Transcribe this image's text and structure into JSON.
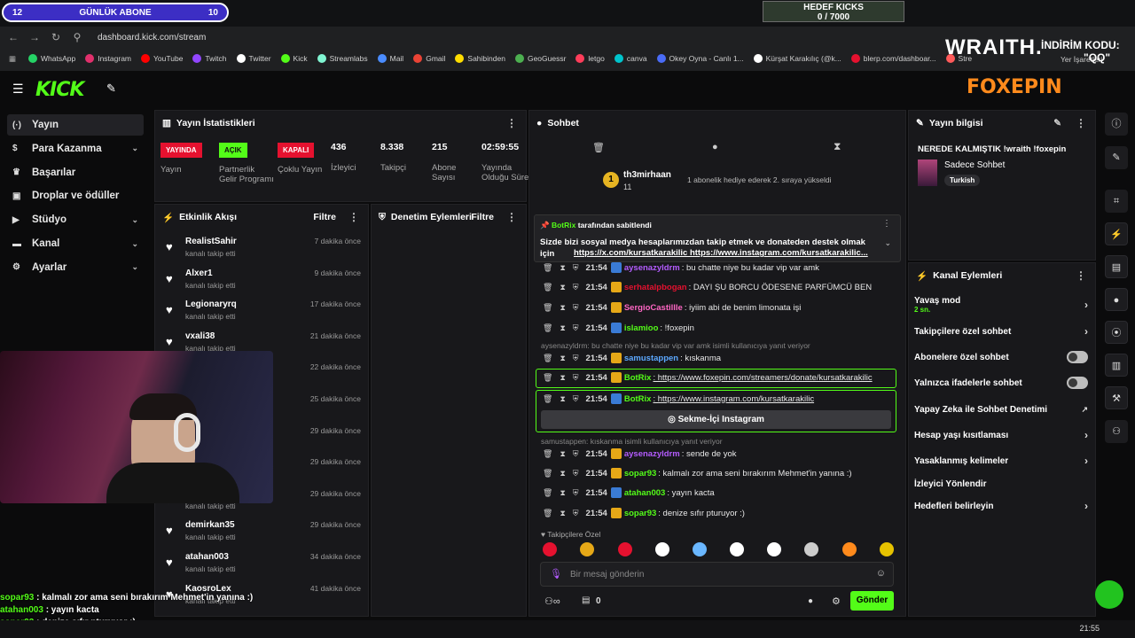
{
  "overlay": {
    "sub_goal": {
      "left": "12",
      "label": "GÜNLÜK ABONE",
      "right": "10"
    },
    "kick_goal": {
      "title": "HEDEF KICKS",
      "value": "0 / 7000"
    },
    "brand": "WRAITH.",
    "promo": "İNDİRİM KODU:",
    "promo_code": "\"QQ\"",
    "sponsor": "FOXEPIN",
    "chat_lines": [
      {
        "user": "sopar93",
        "text": " : kalmalı zor ama seni bırakırım Mehmet'in yanına :)"
      },
      {
        "user": "atahan003",
        "text": " : yayın kacta"
      },
      {
        "user": "sopar93",
        "text": " : denize sıfır pturuyor :)"
      }
    ]
  },
  "browser": {
    "url": "dashboard.kick.com/stream",
    "bookmarks": [
      "WhatsApp",
      "Instagram",
      "YouTube",
      "Twitch",
      "Twitter",
      "Kick",
      "Streamlabs",
      "Mail",
      "Gmail",
      "Sahibinden",
      "GeoGuessr",
      "letgo",
      "canva",
      "Okey Oyna - Canlı 1...",
      "Kürşat Karakılıç (@k...",
      "blerp.com/dashboar...",
      "Stre"
    ],
    "bookmarks_right": "Yer İşaretleri",
    "time": "21:55"
  },
  "sidebar": {
    "items": [
      {
        "label": "Yayın",
        "icon": "(·)"
      },
      {
        "label": "Para Kazanma",
        "icon": "$"
      },
      {
        "label": "Başarılar",
        "icon": "♛"
      },
      {
        "label": "Droplar ve ödüller",
        "icon": "▣"
      },
      {
        "label": "Stüdyo",
        "icon": "▶"
      },
      {
        "label": "Kanal",
        "icon": "▬"
      },
      {
        "label": "Ayarlar",
        "icon": "⚙"
      }
    ]
  },
  "stats": {
    "title": "Yayın İstatistikleri",
    "items": [
      {
        "badge": "YAYINDA",
        "label": "Yayın"
      },
      {
        "badge": "AÇIK",
        "label": "Partnerlik Gelir Programı"
      },
      {
        "badge": "KAPALI",
        "label": "Çoklu Yayın"
      },
      {
        "value": "436",
        "label": "İzleyici"
      },
      {
        "value": "8.338",
        "label": "Takipçi"
      },
      {
        "value": "215",
        "label": "Abone Sayısı"
      },
      {
        "value": "02:59:55",
        "label": "Yayında Olduğu Süre"
      }
    ],
    "colors": {
      "live": "#e5112f",
      "on": "#53fc18",
      "off": "#e5112f"
    }
  },
  "events": {
    "title": "Etkinlik Akışı",
    "filter": "Filtre",
    "items": [
      {
        "name": "RealistSahir",
        "sub": "kanalı takip etti",
        "time": "7 dakika önce"
      },
      {
        "name": "Alxer1",
        "sub": "kanalı takip etti",
        "time": "9 dakika önce"
      },
      {
        "name": "Legionaryrq",
        "sub": "kanalı takip etti",
        "time": "17 dakika önce"
      },
      {
        "name": "vxali38",
        "sub": "kanalı takip etti",
        "time": "21 dakika önce"
      },
      {
        "name": "",
        "sub": "",
        "time": "22 dakika önce"
      },
      {
        "name": "",
        "sub": "",
        "time": "25 dakika önce"
      },
      {
        "name": "",
        "sub": "",
        "time": "29 dakika önce"
      },
      {
        "name": "",
        "sub": "",
        "time": "29 dakika önce"
      },
      {
        "name": "",
        "sub": "kanalı takip etti",
        "time": "29 dakika önce"
      },
      {
        "name": "demirkan35",
        "sub": "kanalı takip etti",
        "time": "29 dakika önce"
      },
      {
        "name": "atahan003",
        "sub": "kanalı takip etti",
        "time": "34 dakika önce"
      },
      {
        "name": "KaosroLex",
        "sub": "kanalı takip etti",
        "time": "41 dakika önce"
      }
    ]
  },
  "moderation": {
    "title": "Denetim Eylemleri",
    "filter": "Filtre"
  },
  "chat": {
    "title": "Sohbet",
    "top_user": "th3mirhaan",
    "top_user_count": "11",
    "top_event": "1 abonelik hediye ederek 2. sıraya yükseldi",
    "pinned_by": "BotRix",
    "pinned_label": "tarafından sabitlendi",
    "pinned_text": "Sizde bizi sosyal medya hesaplarımızdan takip etmek ve donateden destek olmak için",
    "pinned_links": "https://x.com/kursatkarakilic https://www.instagram.com/kursatkarakilic...",
    "messages": [
      {
        "time": "21:54",
        "user": "aysenazyldrm",
        "color": "#b45cff",
        "text": ": bu chatte niye bu kadar vip var amk"
      },
      {
        "time": "21:54",
        "user": "serhatalpbogan",
        "color": "#e5112f",
        "text": ": DAYI ŞU BORCU ÖDESENE PARFÜMCÜ BEN"
      },
      {
        "time": "21:54",
        "user": "SergioCastillle",
        "color": "#ff66c4",
        "text": ": iyiim abi de benim limonata işi"
      },
      {
        "time": "21:54",
        "user": "islamioo",
        "color": "#53fc18",
        "text": ": !foxepin"
      },
      {
        "time": "21:54",
        "user": "samustappen",
        "color": "#5ca8ff",
        "text": ": kıskanma"
      },
      {
        "time": "21:54",
        "user": "BotRix",
        "color": "#53fc18",
        "text": ": https://www.foxepin.com/streamers/donate/kursatkarakilic"
      },
      {
        "time": "21:54",
        "user": "BotRix",
        "color": "#53fc18",
        "text": ": https://www.instagram.com/kursatkarakilic"
      },
      {
        "time": "21:54",
        "user": "aysenazyldrm",
        "color": "#b45cff",
        "text": ": sende de yok"
      },
      {
        "time": "21:54",
        "user": "sopar93",
        "color": "#53fc18",
        "text": ": kalmalı zor ama seni bırakırım Mehmet'in yanına :)"
      },
      {
        "time": "21:54",
        "user": "atahan003",
        "color": "#53fc18",
        "text": ": yayın kacta"
      },
      {
        "time": "21:54",
        "user": "sopar93",
        "color": "#53fc18",
        "text": ": denize sıfır pturuyor :)"
      }
    ],
    "reply1": "aysenazyldrm: bu chatte niye bu kadar vip var amk isimli kullanıcıya yanıt veriyor",
    "reply2": "samustappen: kıskanma isimli kullanıcıya yanıt veriyor",
    "insta_button": "Sekme-İçi Instagram",
    "followers_only": "Takipçilere Özel",
    "input_placeholder": "Bir mesaj gönderin",
    "count": "0",
    "send": "Gönder"
  },
  "streaminfo": {
    "title": "Yayın bilgisi",
    "stream_title": "NEREDE KALMIŞTIK !wraith !foxepin",
    "category": "Sadece Sohbet",
    "language": "Turkish"
  },
  "channel_actions": {
    "title": "Kanal Eylemleri",
    "slow_mode": "Yavaş mod",
    "slow_mode_value": "2 sn.",
    "items": [
      "Takipçilere özel sohbet",
      "Abonelere özel sohbet",
      "Yalnızca ifadelerle sohbet",
      "Yapay Zeka ile Sohbet Denetimi",
      "Hesap yaşı kısıtlaması",
      "Yasaklanmış kelimeler",
      "İzleyici Yönlendir",
      "Hedefleri belirleyin"
    ]
  }
}
